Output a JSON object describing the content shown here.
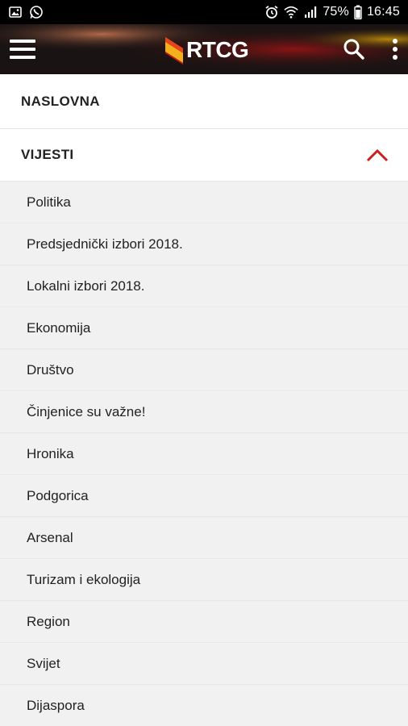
{
  "status_bar": {
    "left_icons": [
      "image-icon",
      "whatsapp-icon"
    ],
    "right_icons": [
      "alarm-icon",
      "wifi-icon",
      "signal-icon"
    ],
    "battery": "75%",
    "time": "16:45"
  },
  "app_bar": {
    "logo_text": "RTCG",
    "menu_icon": "hamburger-icon",
    "search_icon": "search-icon",
    "more_icon": "more-vert-icon"
  },
  "menu": {
    "home": "NASLOVNA",
    "news": "VIJESTI",
    "news_expanded_icon": "chevron-up-icon",
    "accent_color": "#cc1f1f",
    "news_items": [
      "Politika",
      "Predsjednički izbori 2018.",
      "Lokalni izbori 2018.",
      "Ekonomija",
      "Društvo",
      "Činjenice su važne!",
      "Hronika",
      "Podgorica",
      "Arsenal",
      "Turizam i ekologija",
      "Region",
      "Svijet",
      "Dijaspora"
    ]
  }
}
